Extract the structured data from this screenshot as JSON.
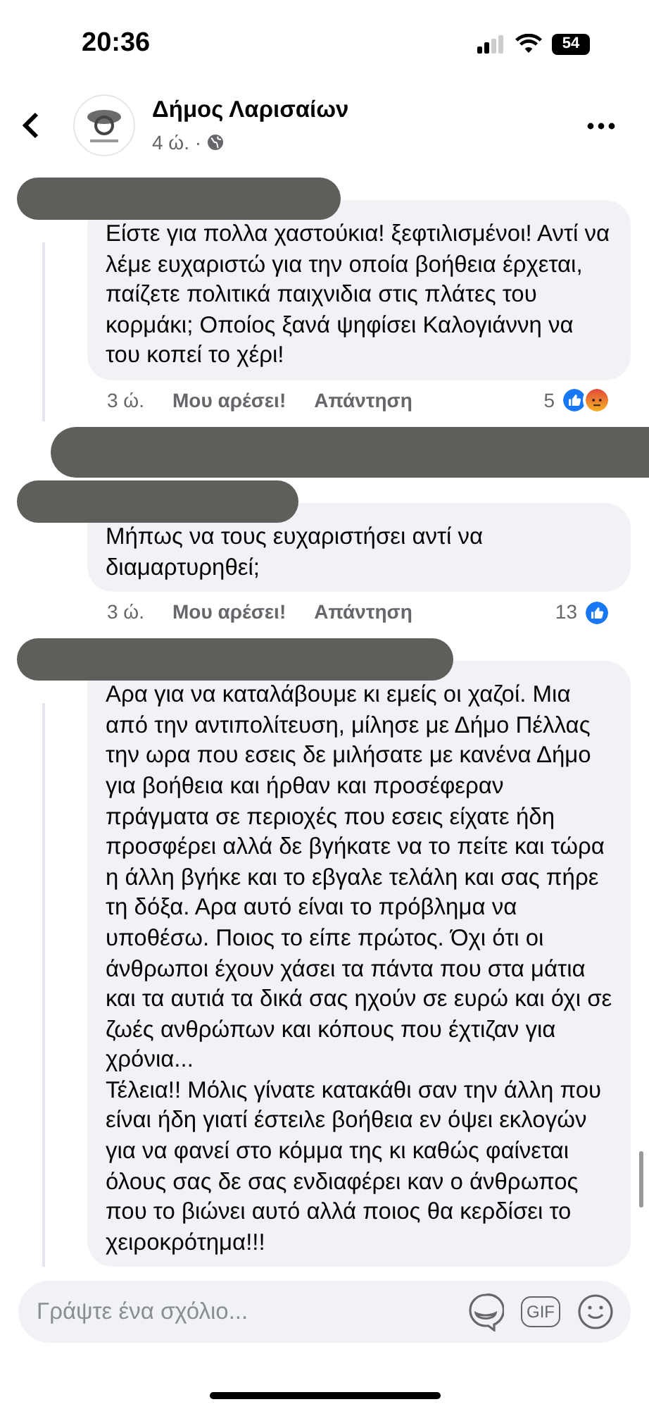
{
  "status_bar": {
    "time": "20:36",
    "battery": "54"
  },
  "header": {
    "page_name": "Δήμος Λαρισαίων",
    "time": "4 ώ. ·"
  },
  "comments": [
    {
      "text": "Είστε για πολλα χαστούκια! ξεφτιλισμένοι! Αντί να λέμε ευχαριστώ για την οποία βοήθεια έρχεται, παίζετε πολιτικά παιχνιδια στις πλάτες του κορμάκι; Οποίος ξανά ψηφίσει Καλογιάννη να του κοπεί το χέρι!",
      "has_replies": true,
      "time": "3 ώ.",
      "like_label": "Μου αρέσει!",
      "reply_label": "Απάντηση",
      "reaction_count": "5",
      "reactions": [
        {
          "kind": "like"
        },
        {
          "kind": "angry"
        }
      ]
    },
    {
      "text": "Μήπως να τους ευχαριστήσει αντί να διαμαρτυρηθεί;",
      "has_replies": false,
      "time": "3 ώ.",
      "like_label": "Μου αρέσει!",
      "reply_label": "Απάντηση",
      "reaction_count": "13",
      "reactions": [
        {
          "kind": "like"
        }
      ]
    },
    {
      "text": "Αρα για να καταλάβουμε κι εμείς οι χαζοί. Μια από την αντιπολίτευση, μίλησε με Δήμο Πέλλας την ωρα που εσεις δε μιλήσατε με κανένα Δήμο για βοήθεια και ήρθαν και προσέφεραν πράγματα σε περιοχές που εσεις είχατε ήδη προσφέρει αλλά δε βγήκατε να το πείτε και τώρα η άλλη βγήκε και το εβγαλε τελάλη και σας πήρε τη δόξα. Αρα αυτό είναι το πρόβλημα να υποθέσω. Ποιος το είπε πρώτος. Όχι ότι οι άνθρωποι έχουν χάσει τα πάντα που στα μάτια και τα αυτιά τα δικά σας ηχούν σε ευρώ και όχι σε ζωές ανθρώπων και κόπους που έχτιζαν για χρόνια...\nΤέλεια!! Μόλις γίνατε κατακάθι σαν την άλλη που είναι ήδη γιατί έστειλε βοήθεια εν όψει εκλογών για να φανεί στο κόμμα της κι καθώς φαίνεται όλους σας δε σας ενδιαφέρει καν ο άνθρωπος που το βιώνει αυτό αλλά ποιος θα κερδίσει το χειροκρότημα!!!",
      "has_replies": true
    }
  ],
  "composer": {
    "placeholder": "Γράψτε ένα σχόλιο...",
    "gif_label": "GIF"
  }
}
